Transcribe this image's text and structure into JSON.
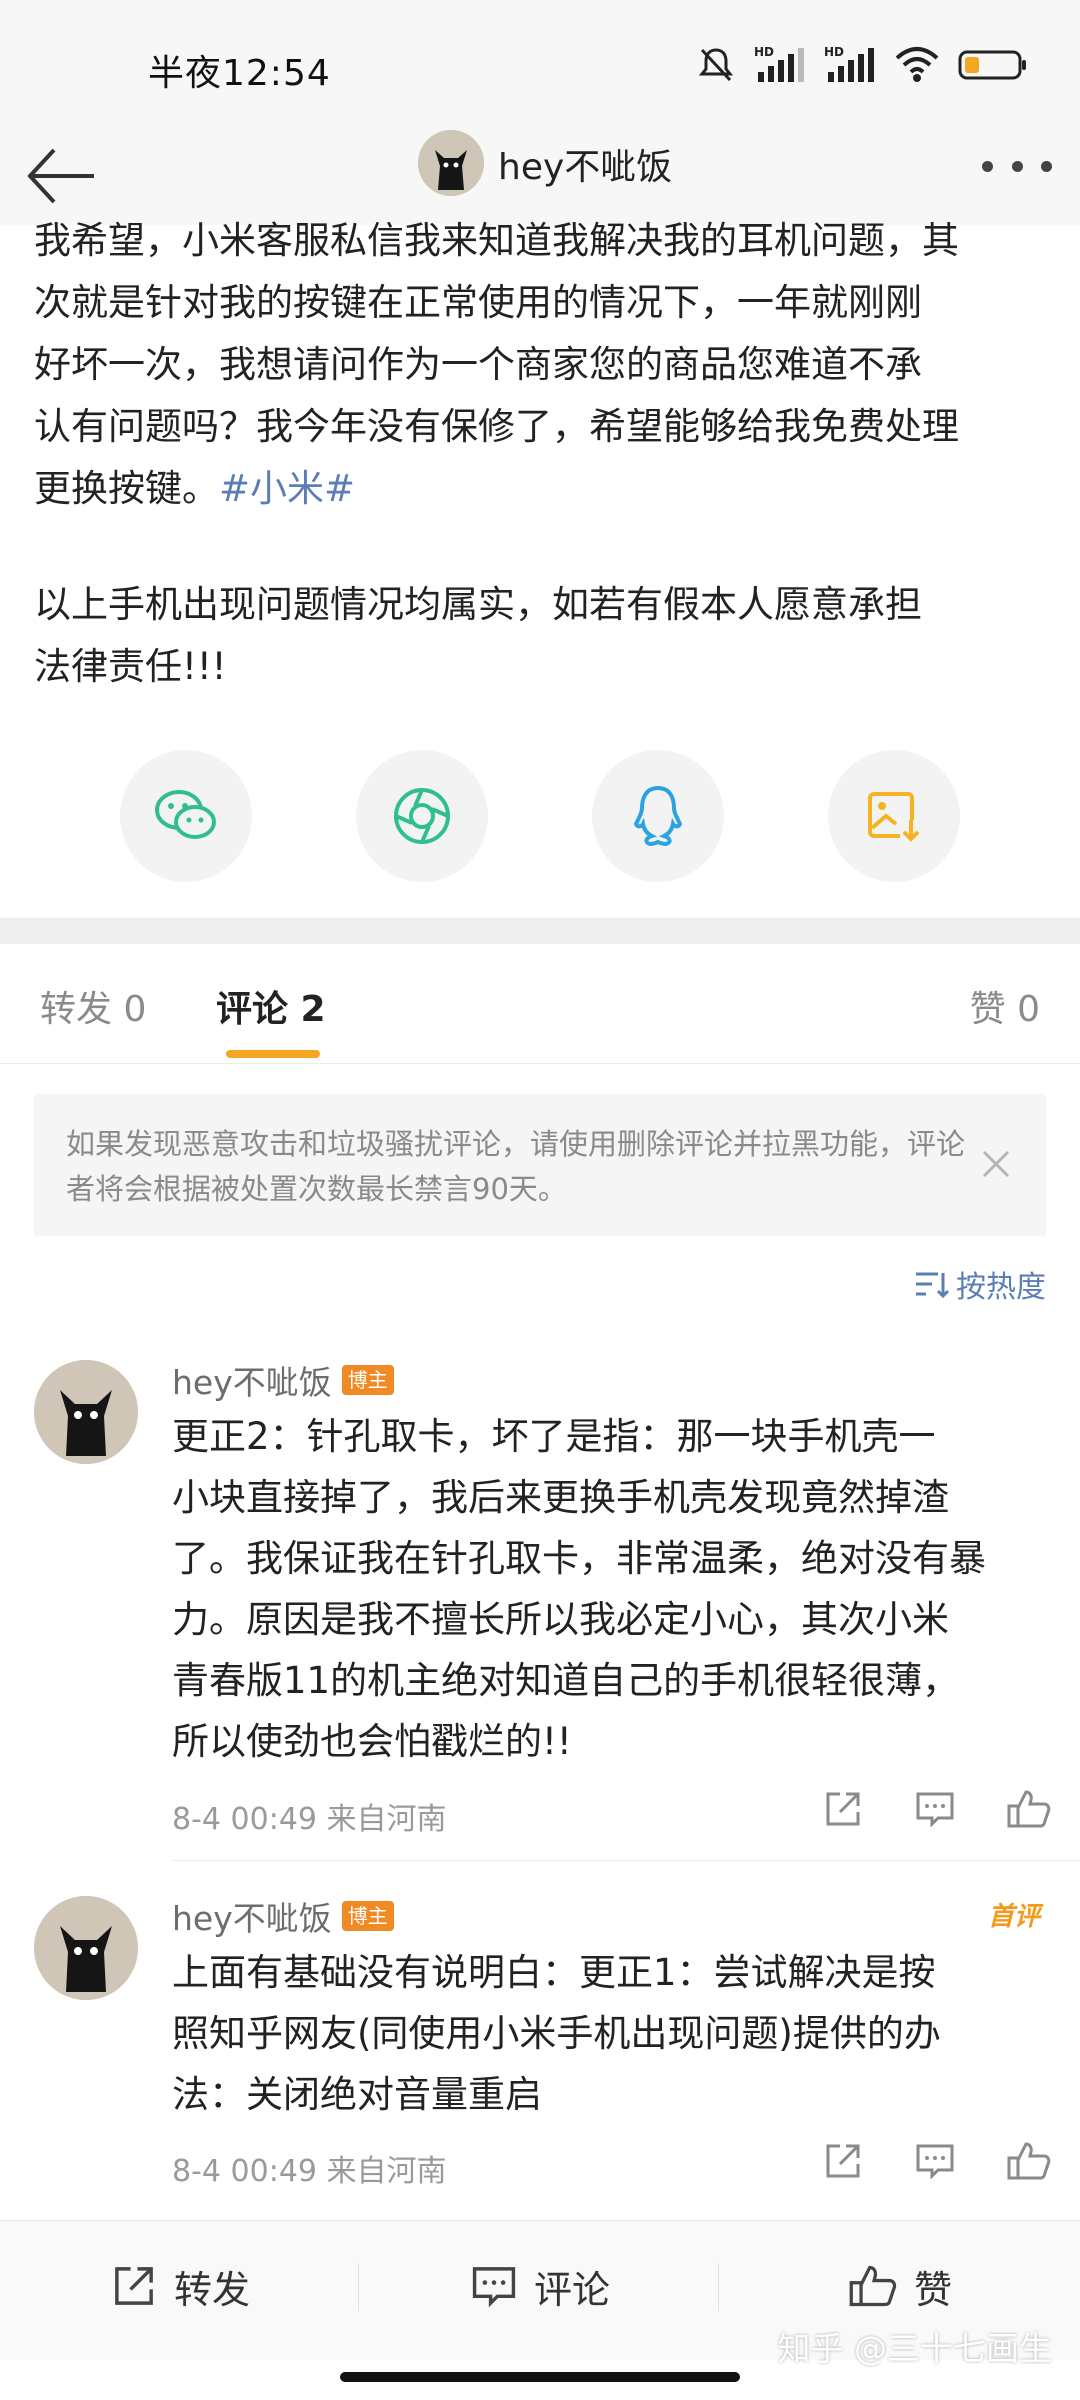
{
  "status_bar": {
    "time": "半夜12:54",
    "icons": [
      "mute-icon",
      "hd-signal-icon",
      "hd-signal-icon",
      "wifi-icon",
      "battery-icon"
    ],
    "hd_label": "HD",
    "battery_color": "#f5a623"
  },
  "nav": {
    "title": "hey不呲饭",
    "back_icon": "back-arrow-icon",
    "more_icon": "more-dots-icon"
  },
  "post": {
    "lines": [
      "我希望，小米客服私信我来知道我解决我的耳机问题，其",
      "次就是针对我的按键在正常使用的情况下，一年就刚刚",
      "好坏一次，我想请问作为一个商家您的商品您难道不承",
      "认有问题吗？我今年没有保修了，希望能够给我免费处理",
      "更换按键。"
    ],
    "hashtag": "#小米#",
    "lines2": [
      "以上手机出现问题情况均属实，如若有假本人愿意承担",
      "法律责任!!!"
    ]
  },
  "share": {
    "buttons": [
      "wechat-icon",
      "moments-icon",
      "qq-icon",
      "save-image-icon"
    ],
    "accent": "#2fbf8f"
  },
  "tabs": {
    "repost": "转发 0",
    "comments": "评论 2",
    "likes": "赞 0",
    "active_color": "#f6a623"
  },
  "notice": {
    "text": "如果发现恶意攻击和垃圾骚扰评论，请使用删除评论并拉黑功能，评论者将会根据被处置次数最长禁言90天。"
  },
  "sort": {
    "label": "按热度"
  },
  "comments": [
    {
      "name": "hey不呲饭",
      "badge": "博主",
      "lines": [
        "更正2：针孔取卡，坏了是指：那一块手机壳一",
        "小块直接掉了，我后来更换手机壳发现竟然掉渣",
        "了。我保证我在针孔取卡，非常温柔，绝对没有暴",
        "力。原因是我不擅长所以我必定小心，其次小米",
        "青春版11的机主绝对知道自己的手机很轻很薄，",
        "所以使劲也会怕戳烂的!!"
      ],
      "meta": "8-4 00:49  来自河南"
    },
    {
      "name": "hey不呲饭",
      "badge": "博主",
      "first_label": "首评",
      "lines": [
        "上面有基础没有说明白：更正1：尝试解决是按",
        "照知乎网友(同使用小米手机出现问题)提供的办",
        "法：关闭绝对音量重启"
      ],
      "meta": "8-4 00:49  来自河南"
    }
  ],
  "bottom_bar": {
    "repost": "转发",
    "comment": "评论",
    "like": "赞"
  },
  "watermark": "知乎 @三十七画生"
}
